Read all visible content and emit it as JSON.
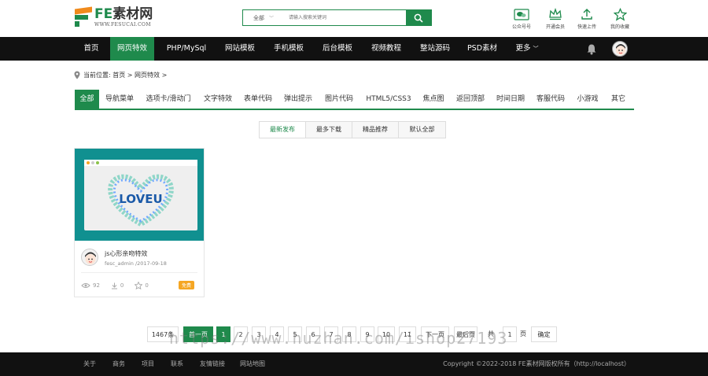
{
  "header": {
    "logo": {
      "brand": "FE",
      "name": "素材网",
      "url": "WWW.FESUCAI.COM"
    },
    "search": {
      "category": "全部",
      "placeholder": "请输入搜索关键词"
    },
    "quick_links": [
      {
        "label": "公众号号",
        "icon": "wechat-icon"
      },
      {
        "label": "开通会员",
        "icon": "crown-icon"
      },
      {
        "label": "快速上传",
        "icon": "upload-icon"
      },
      {
        "label": "我的收藏",
        "icon": "star-icon"
      }
    ]
  },
  "nav": {
    "items": [
      "首页",
      "网页特效",
      "PHP/MySql",
      "网站模板",
      "手机模板",
      "后台模板",
      "视频教程",
      "整站源码",
      "PSD素材",
      "更多"
    ],
    "active_index": 1
  },
  "breadcrumb": {
    "prefix": "当前位置:",
    "home": "首页",
    "sep1": ">",
    "current": "网页特效",
    "sep2": ">"
  },
  "categories": {
    "items": [
      "全部",
      "导航菜单",
      "选项卡/滑动门",
      "文字特效",
      "表单代码",
      "弹出提示",
      "图片代码",
      "HTML5/CSS3",
      "焦点图",
      "返回顶部",
      "时间日期",
      "客服代码",
      "小游戏",
      "其它"
    ],
    "active_index": 0
  },
  "sort_tabs": {
    "items": [
      "最新发布",
      "最多下载",
      "精品推荐",
      "默认全部"
    ],
    "active_index": 0
  },
  "cards": [
    {
      "thumb_text": "LOVEU",
      "title": "js心形亲吻特效",
      "author": "fesc_admin",
      "date": "/2017-09-18",
      "views": "92",
      "downloads": "0",
      "favorites": "0",
      "tag": "免费"
    }
  ],
  "pagination": {
    "total": "1467条",
    "prev": "首一页",
    "pages": [
      "1",
      "2",
      "3",
      "4",
      "5",
      "6",
      "7",
      "8",
      "9",
      "10",
      "11"
    ],
    "current": "1",
    "next": "下一页",
    "last": "最后页",
    "jump_prefix": "共",
    "jump_value": "1",
    "jump_suffix": "页",
    "confirm": "确定"
  },
  "watermark": "https://www.huzhan.com/ishop27193",
  "footer": {
    "links": [
      "关于",
      "商务",
      "项目",
      "联系",
      "友情链接",
      "网站地图"
    ],
    "copyright": "Copyright ©2022-2018 FE素材网版权所有（http://localhost）"
  },
  "colors": {
    "accent": "#1f8a4c",
    "nav_bg": "#111111",
    "thumb_bg": "#109090",
    "tag": "#f5a623"
  }
}
